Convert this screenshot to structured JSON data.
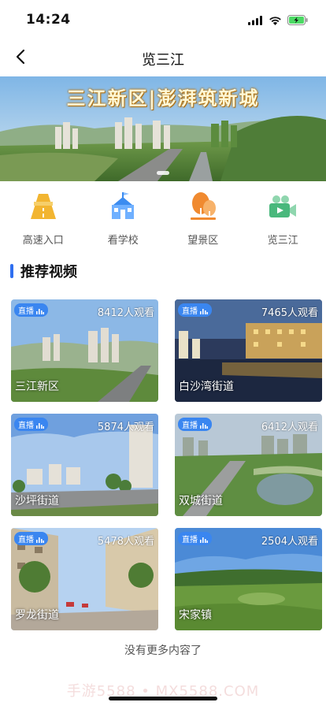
{
  "status_bar": {
    "time": "14:24",
    "icons": [
      "signal-icon",
      "wifi-icon",
      "battery-charging-icon"
    ],
    "battery_color": "#4cd964"
  },
  "nav": {
    "title": "览三江",
    "back_icon": "chevron-left-icon"
  },
  "banner": {
    "title": "三江新区|澎湃筑新城",
    "active_index": 0
  },
  "quick_entries": [
    {
      "label": "高速入口",
      "icon": "highway-icon",
      "color": "#f2b531"
    },
    {
      "label": "看学校",
      "icon": "school-icon",
      "color": "#3c8cf0"
    },
    {
      "label": "望景区",
      "icon": "tree-icon",
      "color": "#f08a30"
    },
    {
      "label": "览三江",
      "icon": "video-camera-icon",
      "color": "#49b87c"
    }
  ],
  "section": {
    "title": "推荐视频",
    "accent": "#2f6ff0"
  },
  "videos": [
    {
      "name": "三江新区",
      "viewers": "8412人观看",
      "badge": "直播"
    },
    {
      "name": "白沙湾街道",
      "viewers": "7465人观看",
      "badge": "直播"
    },
    {
      "name": "沙坪街道",
      "viewers": "5874人观看",
      "badge": "直播"
    },
    {
      "name": "双城街道",
      "viewers": "6412人观看",
      "badge": "直播"
    },
    {
      "name": "罗龙街道",
      "viewers": "5478人观看",
      "badge": "直播"
    },
    {
      "name": "宋家镇",
      "viewers": "2504人观看",
      "badge": "直播"
    }
  ],
  "footer": {
    "no_more": "没有更多内容了",
    "watermark": "手游5588 • MX5588.COM"
  }
}
